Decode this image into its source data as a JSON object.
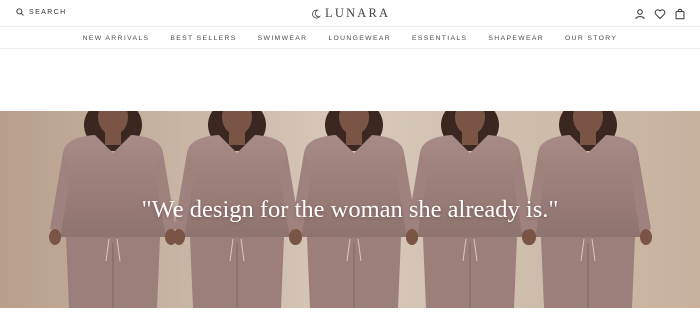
{
  "header": {
    "search_label": "SEARCH",
    "brand": "LUNARA",
    "icons": [
      "search-icon",
      "moon-logo-icon",
      "account-icon",
      "heart-icon",
      "cart-icon"
    ]
  },
  "nav": {
    "items": [
      "NEW ARRIVALS",
      "BEST SELLERS",
      "SWIMWEAR",
      "LOUNGEWEAR",
      "ESSENTIALS",
      "SHAPEWEAR",
      "OUR STORY"
    ]
  },
  "hero": {
    "quote": "\"We design for the woman she already is.\"",
    "colors": {
      "background": "#c9b8a6",
      "garment": "#9c7e7a",
      "skin": "#7a5545",
      "hair": "#3a2820"
    }
  }
}
